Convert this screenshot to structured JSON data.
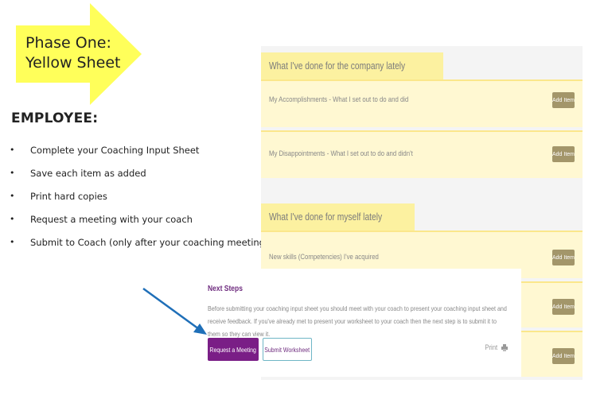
{
  "phase": {
    "line1": "Phase One:",
    "line2": "Yellow Sheet"
  },
  "employee": {
    "title": "EMPLOYEE:",
    "bullet_char": "•",
    "steps": [
      "Complete your Coaching Input Sheet",
      "Save each item as added",
      "Print hard copies",
      "Request a meeting with your coach",
      "Submit to Coach (only after your coaching meeting)"
    ]
  },
  "sections": [
    {
      "title": "What I've done for the company lately",
      "rows": [
        {
          "label": "My Accomplishments - What I set out to do and did",
          "button": "Add Item"
        },
        {
          "label": "My Disappointments - What I set out to do and didn't",
          "button": "Add Item"
        }
      ]
    },
    {
      "title": "What I've done for myself lately",
      "rows": [
        {
          "label": "New skills (Competencies) I've acquired",
          "button": "Add Item"
        },
        {
          "label": "",
          "button": "Add Item"
        },
        {
          "label": "",
          "button": "Add Item"
        }
      ]
    }
  ],
  "next_steps": {
    "title": "Next Steps",
    "description": "Before submitting your coaching input sheet you should meet with your coach to present your coaching input sheet and receive feedback. If you've already met to present your worksheet to your coach then the next step is to submit it to them so they can view it.",
    "request_button": "Request a Meeting",
    "submit_button": "Submit Worksheet",
    "print_label": "Print"
  },
  "colors": {
    "arrow_yellow": "#ffff5a",
    "section_tab": "#fcf1a0",
    "row_bg": "#fff8d2",
    "accent_purple": "#7a1e86",
    "pointer_blue": "#1f6fb8"
  }
}
